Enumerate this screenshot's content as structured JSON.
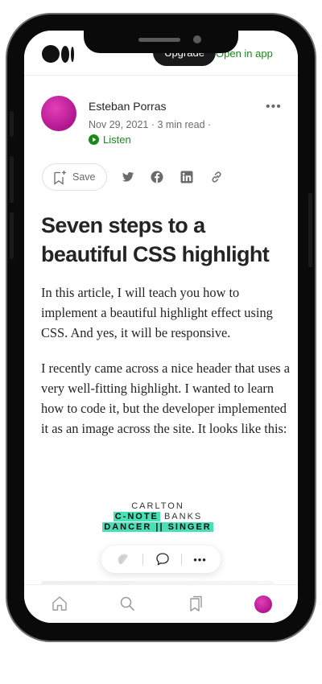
{
  "topbar": {
    "upgrade_label": "Upgrade",
    "open_in_app_label": "Open in app"
  },
  "author": {
    "name": "Esteban Porras",
    "date": "Nov 29, 2021",
    "read_time": "3 min read",
    "listen_label": "Listen"
  },
  "actions": {
    "save_label": "Save",
    "share_icons": [
      "twitter-icon",
      "facebook-icon",
      "linkedin-icon",
      "link-icon"
    ]
  },
  "article": {
    "title": "Seven steps to a beautiful CSS highlight",
    "paragraphs": [
      "In this article, I will teach you how to implement a beautiful highlight effect using CSS. And yes, it will be responsive.",
      "I recently came across a nice header that uses a very well-fitting highlight. I wanted to learn how to code it, but the developer implemented it as an image across the site. It looks like this:"
    ],
    "image": {
      "line1": "CARLTON",
      "line2_highlight": "C-NOTE",
      "line2_rest": " BANKS",
      "line3_highlight": "DANCER || SINGER"
    }
  },
  "colors": {
    "accent_green": "#1a8917",
    "highlight": "#48e0b4",
    "avatar": "#c81ea3"
  },
  "bottom_nav": {
    "icons": [
      "home-icon",
      "search-icon",
      "bookmarks-icon",
      "profile-avatar"
    ]
  }
}
